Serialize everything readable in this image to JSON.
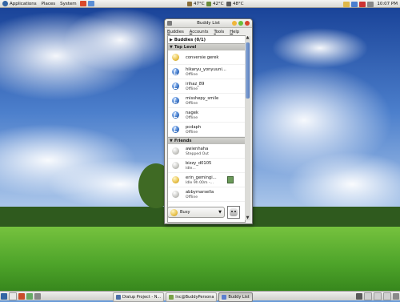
{
  "top_panel": {
    "menus": [
      "Applications",
      "Places",
      "System"
    ],
    "temps": [
      "47°C",
      "42°C",
      "48°C"
    ],
    "clock": "10:07 PM"
  },
  "buddy_window": {
    "title": "Buddy List",
    "menu": [
      "Buddies",
      "Accounts",
      "Tools",
      "Help"
    ],
    "buddies_label": "Buddies (0/1)",
    "groups": [
      {
        "name": "Top Level",
        "buddies": [
          {
            "name": "conversie gerek",
            "status": "",
            "type": "online"
          },
          {
            "name": "hikaryu_yonyuuni...",
            "status": "Offline",
            "type": "offline"
          },
          {
            "name": "irihaz_89",
            "status": "Offline",
            "type": "offline"
          },
          {
            "name": "misshepy_smile",
            "status": "Offline",
            "type": "offline"
          },
          {
            "name": "nagek",
            "status": "Offline",
            "type": "offline"
          },
          {
            "name": "pcdaph",
            "status": "Offline",
            "type": "offline"
          }
        ]
      },
      {
        "name": "Friends",
        "buddies": [
          {
            "name": "awienhaha",
            "status": "Stepped Out",
            "type": "away"
          },
          {
            "name": "bizzy_d0105",
            "status": "Idle...",
            "type": "away"
          },
          {
            "name": "erin_gemingi...",
            "status": "Idle 9h 00m -...",
            "type": "online"
          },
          {
            "name": "abbymarsella",
            "status": "Offline",
            "type": "away"
          }
        ]
      }
    ],
    "status_value": "Busy"
  },
  "taskbar": {
    "tasks": [
      "Dialup Project - N...",
      "Inc@BuddyPersona",
      "Buddy List"
    ]
  },
  "colors": {
    "sky_top": "#1f4fa8",
    "grass": "#4fa829",
    "panel": "#e2e2de"
  }
}
